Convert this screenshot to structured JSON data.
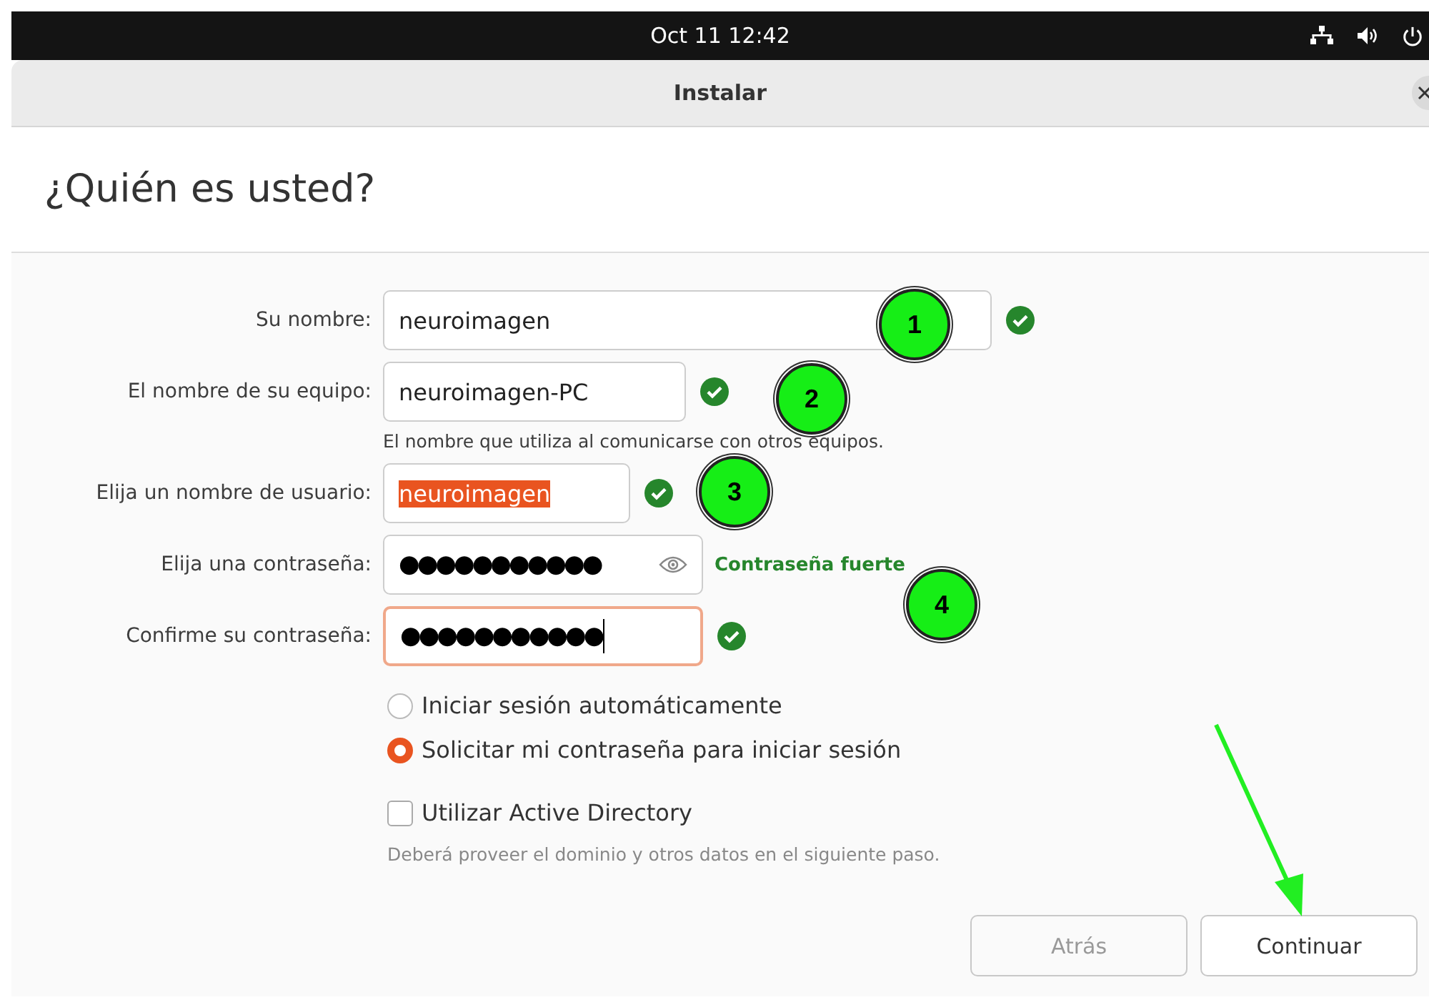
{
  "top_bar": {
    "clock": "Oct 11  12:42"
  },
  "window": {
    "title": "Instalar"
  },
  "heading": "¿Quién es usted?",
  "fields": [
    {
      "label": "Su nombre:",
      "value": "neuroimagen",
      "valid": true,
      "text_selected": false,
      "focused": false,
      "kind": "text"
    },
    {
      "label": "El nombre de su equipo:",
      "value": "neuroimagen-PC",
      "valid": true,
      "text_selected": false,
      "focused": false,
      "kind": "text",
      "hint": "El nombre que utiliza al comunicarse con otros equipos."
    },
    {
      "label": "Elija un nombre de usuario:",
      "value": "neuroimagen",
      "valid": true,
      "text_selected": true,
      "focused": false,
      "kind": "text"
    },
    {
      "label": "Elija una contraseña:",
      "value": "●●●●●●●●●●●",
      "valid": false,
      "text_selected": false,
      "focused": false,
      "kind": "password",
      "strength": "Contraseña fuerte"
    },
    {
      "label": "Confirme su contraseña:",
      "value": "●●●●●●●●●●●",
      "valid": true,
      "text_selected": false,
      "focused": true,
      "kind": "text"
    }
  ],
  "login_options": [
    {
      "label": "Iniciar sesión automáticamente",
      "selected": false
    },
    {
      "label": "Solicitar mi contraseña para iniciar sesión",
      "selected": true
    }
  ],
  "active_directory": {
    "label": "Utilizar Active Directory",
    "checked": false,
    "hint": "Deberá proveer el dominio y otros datos en el siguiente paso."
  },
  "buttons": [
    {
      "label": "Atrás",
      "disabled": true
    },
    {
      "label": "Continuar",
      "disabled": false
    }
  ],
  "annotations": [
    "1",
    "2",
    "3",
    "4"
  ]
}
